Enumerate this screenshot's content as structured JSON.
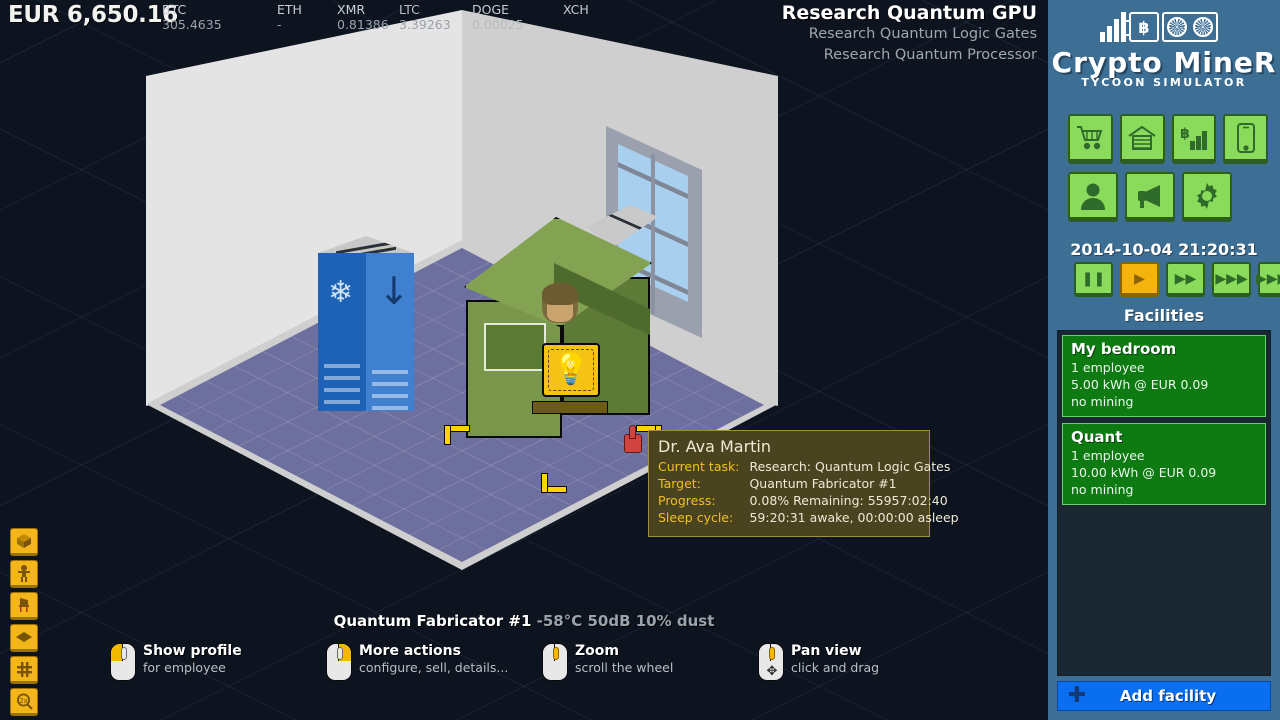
{
  "ticker": {
    "balance": "EUR 6,650.16",
    "coins": [
      {
        "symbol": "BTC",
        "value": "305.4635"
      },
      {
        "symbol": "ETH",
        "value": "-"
      },
      {
        "symbol": "XMR",
        "value": "0.81386"
      },
      {
        "symbol": "LTC",
        "value": "3.39263"
      },
      {
        "symbol": "DOGE",
        "value": "0.00025"
      },
      {
        "symbol": "XCH",
        "value": ""
      }
    ]
  },
  "research": {
    "line1": "Research Quantum GPU",
    "line2": "Research Quantum Logic Gates",
    "line3": "Research Quantum Processor"
  },
  "tooltip": {
    "name": "Dr. Ava Martin",
    "rows": [
      {
        "key": "Current task:",
        "value": "Research: Quantum Logic Gates"
      },
      {
        "key": "Target:",
        "value": "Quantum Fabricator #1"
      },
      {
        "key": "Progress:",
        "value": "0.08%  Remaining: 55957:02:40"
      },
      {
        "key": "Sleep cycle:",
        "value": "59:20:31 awake, 00:00:00 asleep"
      }
    ]
  },
  "status": {
    "object": "Quantum Fabricator #1",
    "environment": "-58°C 50dB 10% dust"
  },
  "hints": [
    {
      "title": "Show profile",
      "sub": "for employee",
      "button": "left"
    },
    {
      "title": "More actions",
      "sub": "configure, sell, details...",
      "button": "right"
    },
    {
      "title": "Zoom",
      "sub": "scroll the wheel",
      "button": "wheel"
    },
    {
      "title": "Pan view",
      "sub": "click and drag",
      "button": "wheel-drag"
    }
  ],
  "rail": [
    {
      "icon": "cube-icon",
      "glyph": "◱"
    },
    {
      "icon": "person-icon",
      "glyph": "웃"
    },
    {
      "icon": "furniture-icon",
      "glyph": "🪑"
    },
    {
      "icon": "floor-tile-icon",
      "glyph": "◆"
    },
    {
      "icon": "grid-icon",
      "glyph": "#"
    },
    {
      "icon": "zoom-2x-icon",
      "glyph": "2x"
    }
  ],
  "sidebar": {
    "logo": {
      "title": "Crypto MineR",
      "subtitle": "TYCOON SIMULATOR"
    },
    "buttons_row1": [
      {
        "name": "shop-button",
        "icon": "shopping-cart-icon"
      },
      {
        "name": "warehouse-button",
        "icon": "warehouse-icon"
      },
      {
        "name": "market-button",
        "icon": "bitcoin-chart-icon"
      },
      {
        "name": "phone-button",
        "icon": "smartphone-icon"
      }
    ],
    "buttons_row2": [
      {
        "name": "employees-button",
        "icon": "person-icon"
      },
      {
        "name": "marketing-button",
        "icon": "megaphone-icon"
      },
      {
        "name": "settings-button",
        "icon": "gear-icon"
      }
    ],
    "clock": "2014-10-04 21:20:31",
    "speeds": [
      {
        "name": "pause-button",
        "label": "❚❚",
        "active": false
      },
      {
        "name": "play-button",
        "label": "▶",
        "active": true
      },
      {
        "name": "speed-2x-button",
        "label": "▶▶",
        "active": false
      },
      {
        "name": "speed-3x-button",
        "label": "▶▶▶",
        "active": false
      },
      {
        "name": "speed-4x-button",
        "label": "▶▶▶▶",
        "active": false
      }
    ],
    "facilities_title": "Facilities",
    "facilities": [
      {
        "name": "My bedroom",
        "employees": "1 employee",
        "power": "5.00 kWh @ EUR 0.09",
        "mining": "no mining"
      },
      {
        "name": "Quant",
        "employees": "1 employee",
        "power": "10.00 kWh @ EUR 0.09",
        "mining": "no mining"
      }
    ],
    "add_facility": "Add facility"
  },
  "colors": {
    "sidebar": "#3d6e94",
    "facility": "#0d7a12",
    "accent_green": "#8ada5c",
    "accent_yellow": "#f5b30e",
    "add_blue": "#0a6ef0",
    "tooltip_bg": "#4a431f",
    "tooltip_key": "#f0c020"
  }
}
